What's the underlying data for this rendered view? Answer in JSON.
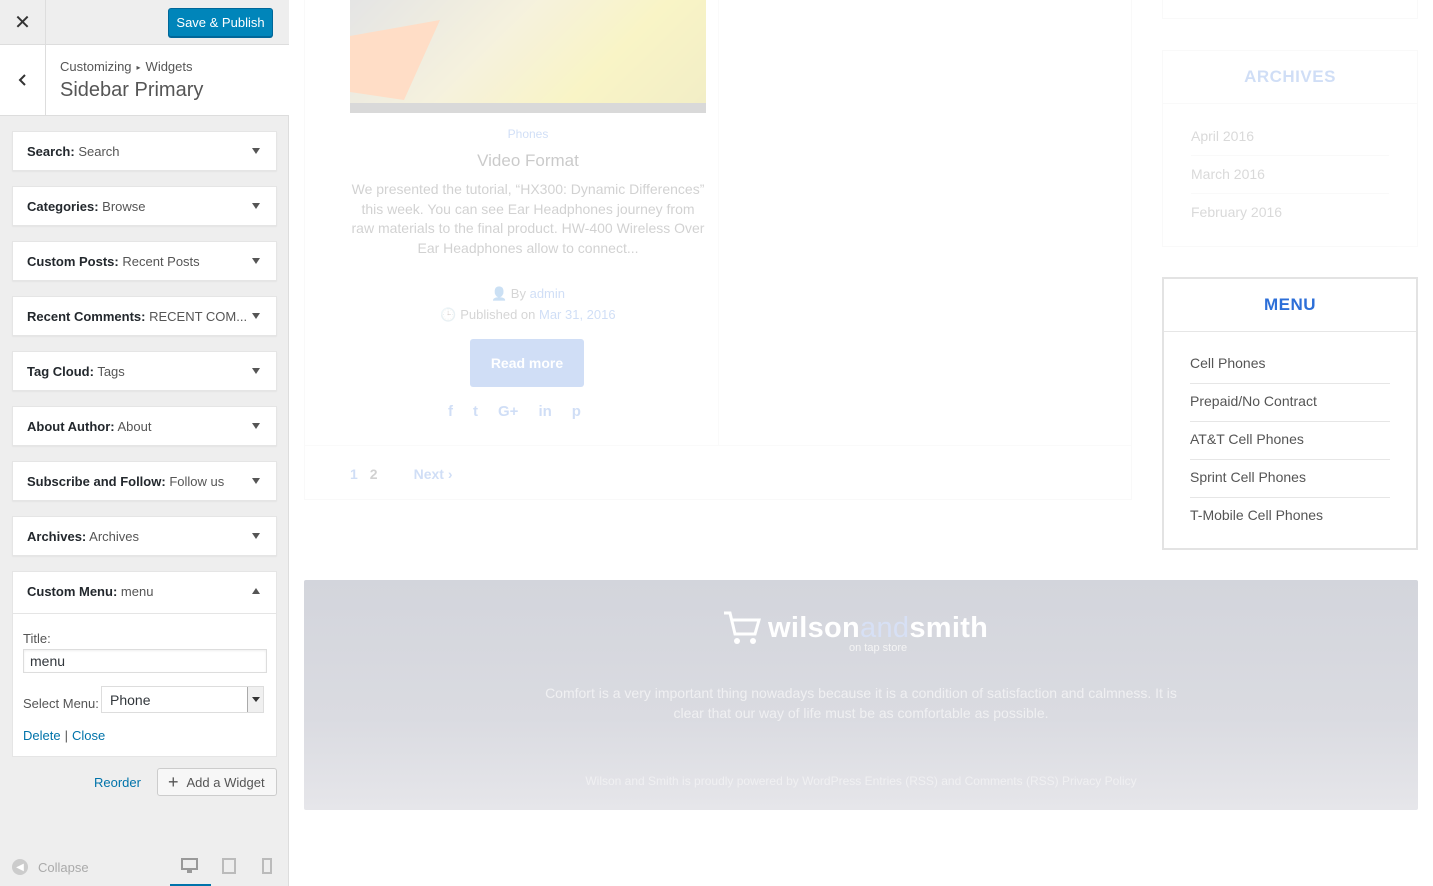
{
  "topbar": {
    "close_label": "✕",
    "publish_label": "Save & Publish"
  },
  "section": {
    "breadcrumb_root": "Customizing",
    "breadcrumb_sep": "▸",
    "breadcrumb_current": "Widgets",
    "title": "Sidebar Primary"
  },
  "widgets": [
    {
      "type": "Search:",
      "name": "Search"
    },
    {
      "type": "Categories:",
      "name": "Browse"
    },
    {
      "type": "Custom Posts:",
      "name": "Recent Posts"
    },
    {
      "type": "Recent Comments:",
      "name": "RECENT COM..."
    },
    {
      "type": "Tag Cloud:",
      "name": "Tags"
    },
    {
      "type": "About Author:",
      "name": "About"
    },
    {
      "type": "Subscribe and Follow:",
      "name": "Follow us"
    },
    {
      "type": "Archives:",
      "name": "Archives"
    }
  ],
  "open_widget": {
    "type": "Custom Menu:",
    "name": "menu",
    "title_label": "Title:",
    "title_value": "menu",
    "select_label": "Select Menu:",
    "select_value": "Phone",
    "delete_label": "Delete",
    "pipe": "|",
    "close_label": "Close"
  },
  "actions": {
    "reorder_label": "Reorder",
    "add_widget_label": "Add a Widget"
  },
  "footer_controls": {
    "collapse_label": "Collapse"
  },
  "preview": {
    "post": {
      "category": "Phones",
      "title": "Video Format",
      "excerpt": "We presented the tutorial, “HX300: Dynamic Differences” this week. You can see Ear Headphones journey from raw materials to the final product. HW-400 Wireless Over Ear Headphones allow to connect...",
      "by_prefix": "By",
      "author": "admin",
      "published_prefix": "Published on",
      "date": "Mar 31, 2016",
      "read_more": "Read more",
      "social": [
        "f",
        "t",
        "G+",
        "in",
        "p"
      ]
    },
    "pagination": {
      "page1": "1",
      "page2": "2",
      "next": "Next ›"
    },
    "archives": {
      "title": "ARCHIVES",
      "items": [
        "April 2016",
        "March 2016",
        "February 2016"
      ]
    },
    "menu": {
      "title": "MENU",
      "items": [
        "Cell Phones",
        "Prepaid/No Contract",
        "AT&T Cell Phones",
        "Sprint Cell Phones",
        "T-Mobile Cell Phones"
      ]
    },
    "footer": {
      "logo_wilson": "wilson",
      "logo_and": "and",
      "logo_smith": "smith",
      "tagline": "on tap store",
      "description": "Comfort is a very important thing nowadays because it is a condition of satisfaction and calmness. It is clear that our way of life must be as comfortable as possible.",
      "credit": "Wilson and Smith is proudly powered by WordPress Entries (RSS) and Comments (RSS) Privacy Policy"
    }
  },
  "colors": {
    "accent": "#0085ba",
    "link": "#0073aa",
    "brand_blue": "#2d6fd8"
  }
}
